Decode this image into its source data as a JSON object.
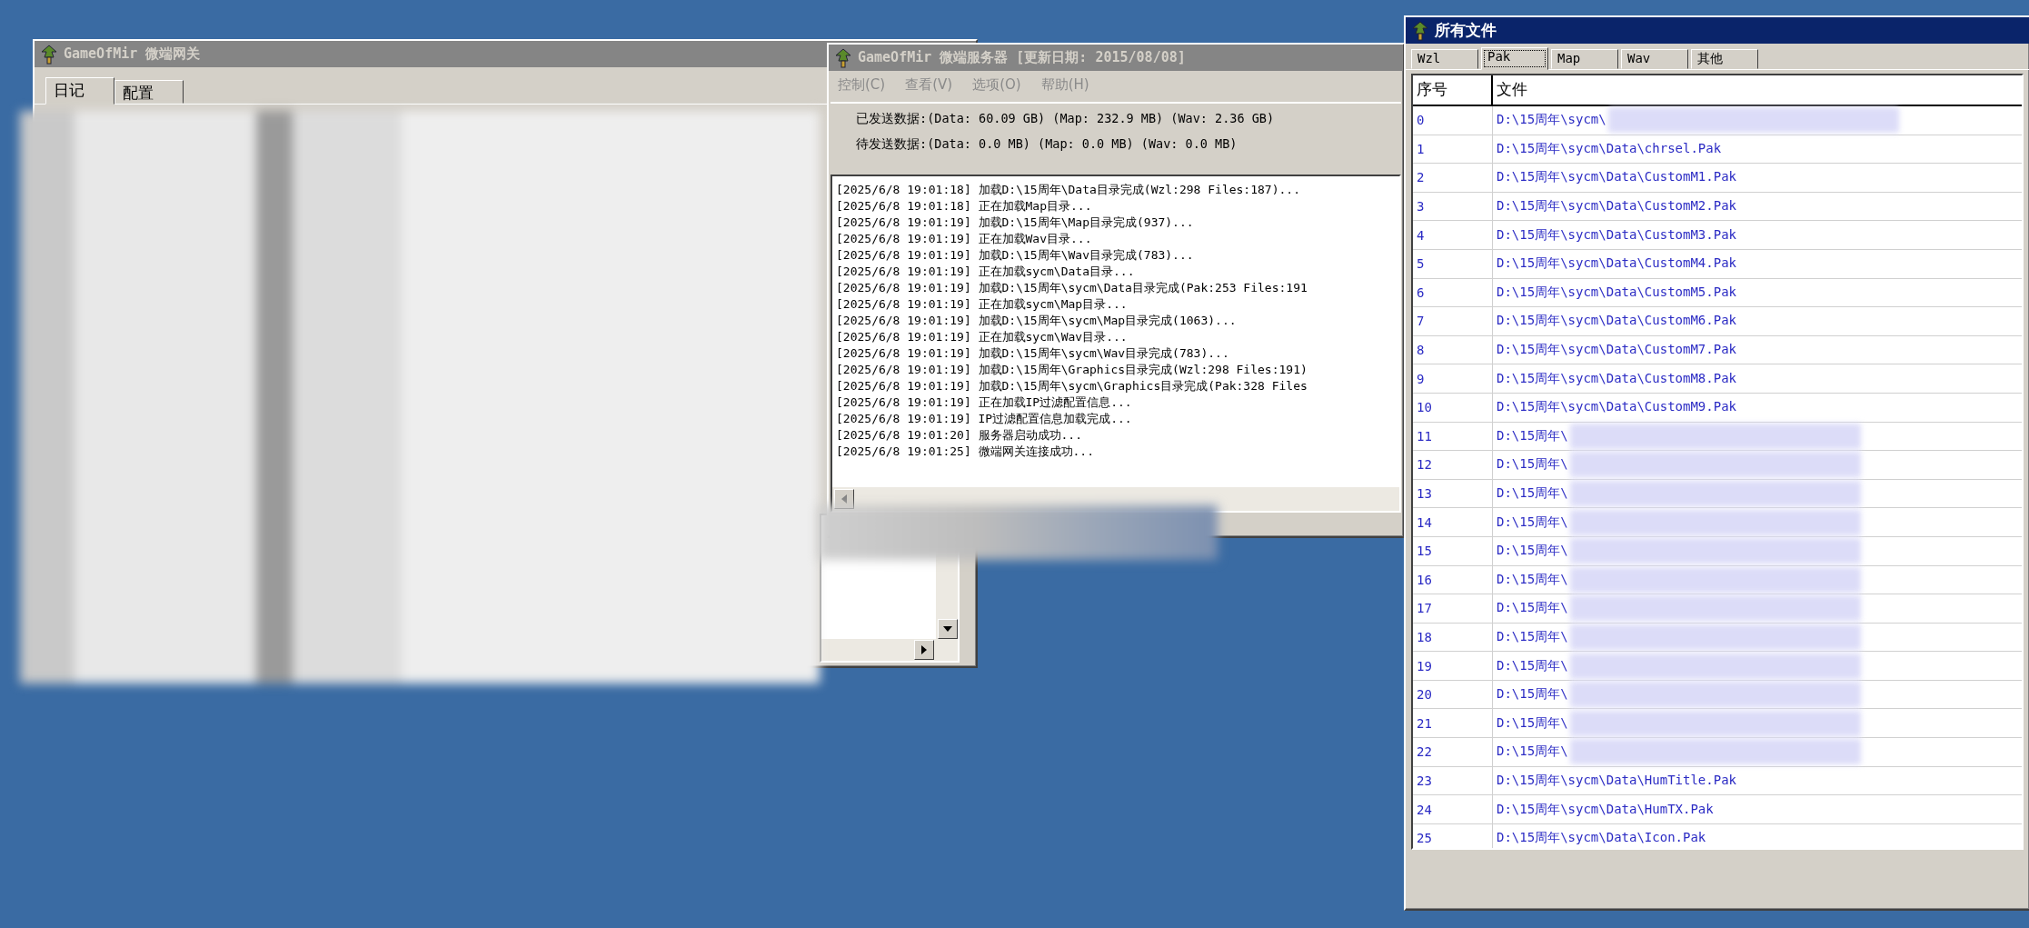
{
  "gateway_window": {
    "title": "GameOfMir 微端网关",
    "tabs": [
      {
        "label": "日记",
        "selected": true
      },
      {
        "label": "配置",
        "selected": false
      }
    ]
  },
  "server_window": {
    "title": "GameOfMir 微端服务器 [更新日期: 2015/08/08]",
    "menu": [
      "控制(C)",
      "查看(V)",
      "选项(O)",
      "帮助(H)"
    ],
    "stats": [
      "已发送数据:(Data: 60.09 GB) (Map: 232.9 MB) (Wav: 2.36 GB)",
      "待发送数据:(Data: 0.0 MB) (Map: 0.0 MB) (Wav: 0.0 MB)"
    ],
    "log": [
      "[2025/6/8 19:01:18] 加载D:\\15周年\\Data目录完成(Wzl:298 Files:187)...",
      "[2025/6/8 19:01:18] 正在加载Map目录...",
      "[2025/6/8 19:01:19] 加载D:\\15周年\\Map目录完成(937)...",
      "[2025/6/8 19:01:19] 正在加载Wav目录...",
      "[2025/6/8 19:01:19] 加载D:\\15周年\\Wav目录完成(783)...",
      "[2025/6/8 19:01:19] 正在加载sycm\\Data目录...",
      "[2025/6/8 19:01:19] 加载D:\\15周年\\sycm\\Data目录完成(Pak:253 Files:191",
      "[2025/6/8 19:01:19] 正在加载sycm\\Map目录...",
      "[2025/6/8 19:01:19] 加载D:\\15周年\\sycm\\Map目录完成(1063)...",
      "[2025/6/8 19:01:19] 正在加载sycm\\Wav目录...",
      "[2025/6/8 19:01:19] 加载D:\\15周年\\sycm\\Wav目录完成(783)...",
      "[2025/6/8 19:01:19] 加载D:\\15周年\\Graphics目录完成(Wzl:298 Files:191)",
      "[2025/6/8 19:01:19] 加载D:\\15周年\\sycm\\Graphics目录完成(Pak:328 Files",
      "[2025/6/8 19:01:19] 正在加载IP过滤配置信息...",
      "[2025/6/8 19:01:19] IP过滤配置信息加载完成...",
      "[2025/6/8 19:01:20] 服务器启动成功...",
      "[2025/6/8 19:01:25] 微端网关连接成功..."
    ]
  },
  "files_window": {
    "title": "所有文件",
    "tabs": [
      {
        "label": "Wzl",
        "selected": false
      },
      {
        "label": "Pak",
        "selected": true
      },
      {
        "label": "Map",
        "selected": false
      },
      {
        "label": "Wav",
        "selected": false
      },
      {
        "label": "其他",
        "selected": false
      }
    ],
    "columns": [
      "序号",
      "文件"
    ],
    "rows": [
      {
        "index": "0",
        "file": "D:\\15周年\\sycm\\",
        "blurred": true
      },
      {
        "index": "1",
        "file": "D:\\15周年\\sycm\\Data\\chrsel.Pak",
        "blurred": false
      },
      {
        "index": "2",
        "file": "D:\\15周年\\sycm\\Data\\CustomM1.Pak",
        "blurred": false
      },
      {
        "index": "3",
        "file": "D:\\15周年\\sycm\\Data\\CustomM2.Pak",
        "blurred": false
      },
      {
        "index": "4",
        "file": "D:\\15周年\\sycm\\Data\\CustomM3.Pak",
        "blurred": false
      },
      {
        "index": "5",
        "file": "D:\\15周年\\sycm\\Data\\CustomM4.Pak",
        "blurred": false
      },
      {
        "index": "6",
        "file": "D:\\15周年\\sycm\\Data\\CustomM5.Pak",
        "blurred": false
      },
      {
        "index": "7",
        "file": "D:\\15周年\\sycm\\Data\\CustomM6.Pak",
        "blurred": false
      },
      {
        "index": "8",
        "file": "D:\\15周年\\sycm\\Data\\CustomM7.Pak",
        "blurred": false
      },
      {
        "index": "9",
        "file": "D:\\15周年\\sycm\\Data\\CustomM8.Pak",
        "blurred": false
      },
      {
        "index": "10",
        "file": "D:\\15周年\\sycm\\Data\\CustomM9.Pak",
        "blurred": false
      },
      {
        "index": "11",
        "file": "D:\\15周年\\",
        "blurred": true
      },
      {
        "index": "12",
        "file": "D:\\15周年\\",
        "blurred": true
      },
      {
        "index": "13",
        "file": "D:\\15周年\\",
        "blurred": true
      },
      {
        "index": "14",
        "file": "D:\\15周年\\",
        "blurred": true
      },
      {
        "index": "15",
        "file": "D:\\15周年\\",
        "blurred": true
      },
      {
        "index": "16",
        "file": "D:\\15周年\\",
        "blurred": true
      },
      {
        "index": "17",
        "file": "D:\\15周年\\",
        "blurred": true
      },
      {
        "index": "18",
        "file": "D:\\15周年\\",
        "blurred": true
      },
      {
        "index": "19",
        "file": "D:\\15周年\\",
        "blurred": true
      },
      {
        "index": "20",
        "file": "D:\\15周年\\",
        "blurred": true
      },
      {
        "index": "21",
        "file": "D:\\15周年\\",
        "blurred": true
      },
      {
        "index": "22",
        "file": "D:\\15周年\\",
        "blurred": true
      },
      {
        "index": "23",
        "file": "D:\\15周年\\sycm\\Data\\HumTitle.Pak",
        "blurred": false
      },
      {
        "index": "24",
        "file": "D:\\15周年\\sycm\\Data\\HumTX.Pak",
        "blurred": false
      },
      {
        "index": "25",
        "file": "D:\\15周年\\sycm\\Data\\Icon.Pak",
        "blurred": false
      }
    ]
  }
}
